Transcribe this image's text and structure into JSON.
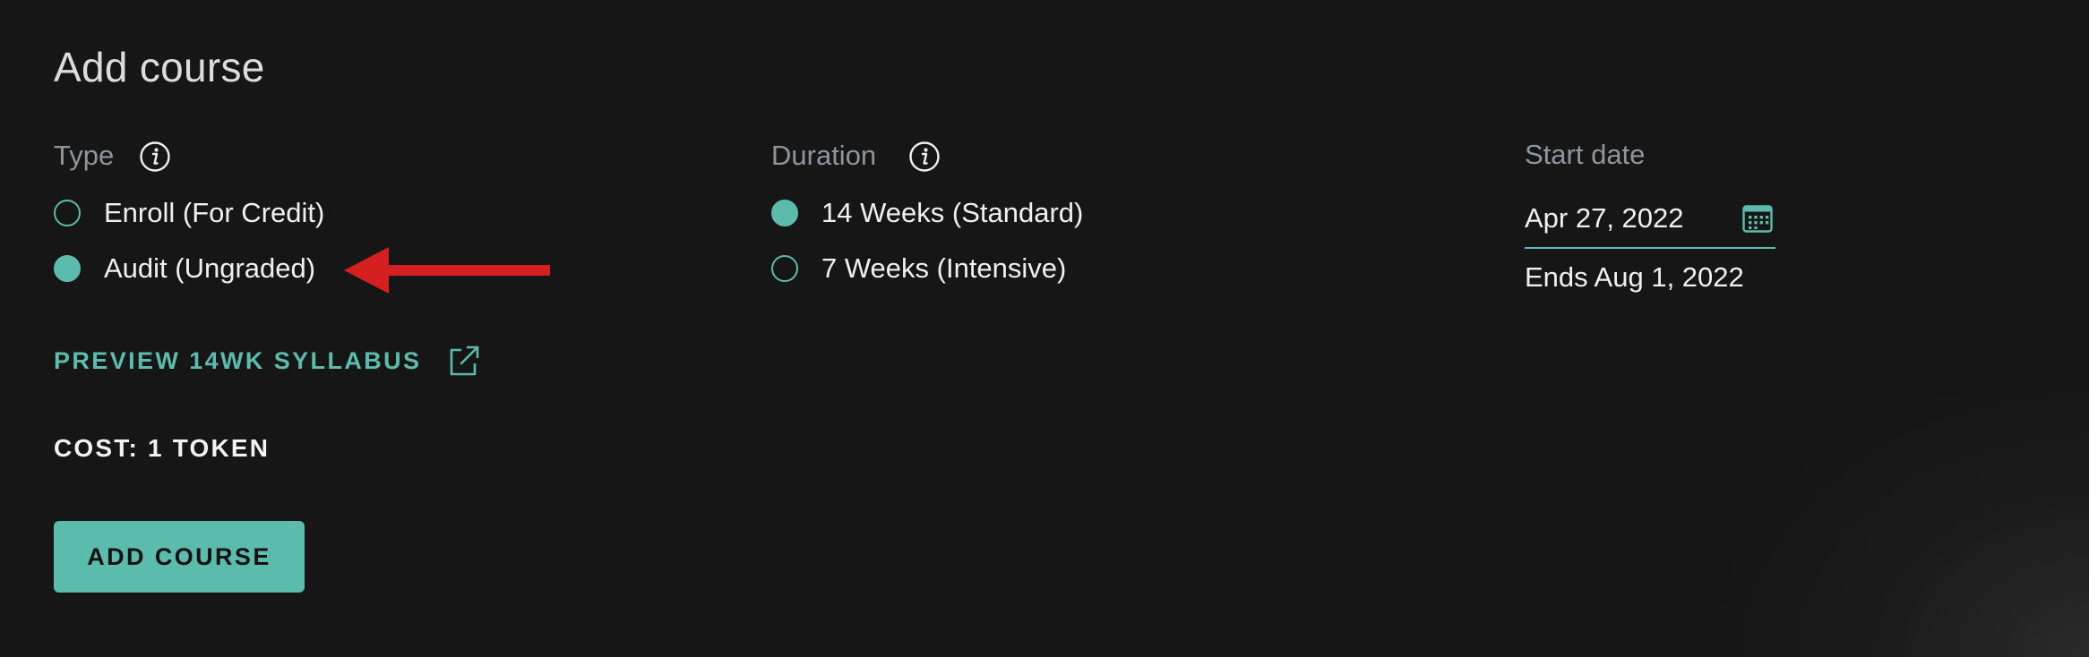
{
  "page": {
    "title": "Add course"
  },
  "type_field": {
    "label": "Type",
    "info_icon": "info-icon",
    "options": [
      {
        "label": "Enroll (For Credit)",
        "selected": false
      },
      {
        "label": "Audit (Ungraded)",
        "selected": true
      }
    ]
  },
  "duration_field": {
    "label": "Duration",
    "info_icon": "info-icon",
    "options": [
      {
        "label": "14 Weeks (Standard)",
        "selected": true
      },
      {
        "label": "7 Weeks (Intensive)",
        "selected": false
      }
    ]
  },
  "start_date_field": {
    "label": "Start date",
    "value": "Apr 27, 2022",
    "icon": "calendar-icon",
    "ends_text": "Ends Aug 1, 2022"
  },
  "preview_link": {
    "label": "PREVIEW 14WK SYLLABUS",
    "icon": "external-link-icon"
  },
  "cost": {
    "label": "COST: 1 TOKEN"
  },
  "add_button": {
    "label": "ADD COURSE"
  },
  "annotation": {
    "arrow_color": "#d42020",
    "points_to": "Audit (Ungraded)"
  },
  "colors": {
    "background": "#161616",
    "accent": "#5bbcad",
    "muted_label": "#8f959c",
    "text": "#f0f0f0"
  }
}
